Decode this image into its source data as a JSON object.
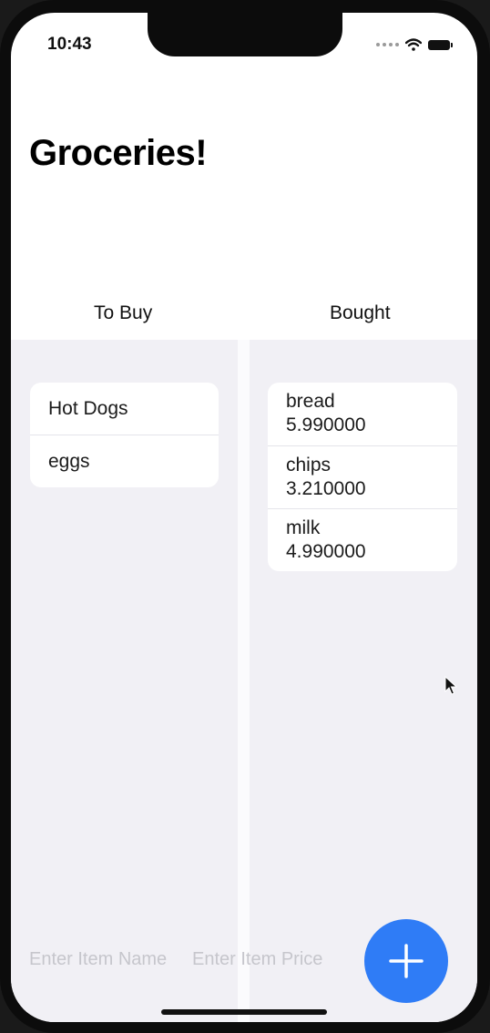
{
  "status_bar": {
    "time": "10:43",
    "icons": [
      "signal-dots-icon",
      "wifi-icon",
      "battery-icon"
    ]
  },
  "header": {
    "title": "Groceries!"
  },
  "columns": {
    "to_buy": {
      "label": "To Buy",
      "items": [
        {
          "name": "Hot Dogs"
        },
        {
          "name": "eggs"
        }
      ]
    },
    "bought": {
      "label": "Bought",
      "items": [
        {
          "name": "bread",
          "price": "5.990000"
        },
        {
          "name": "chips",
          "price": "3.210000"
        },
        {
          "name": "milk",
          "price": "4.990000"
        }
      ]
    }
  },
  "footer": {
    "item_name_placeholder": "Enter Item Name",
    "item_price_placeholder": "Enter Item Price",
    "add_icon": "plus-icon"
  },
  "colors": {
    "accent": "#2f7cf6",
    "list_background": "#f1f0f5",
    "placeholder": "#c6c6cc"
  }
}
